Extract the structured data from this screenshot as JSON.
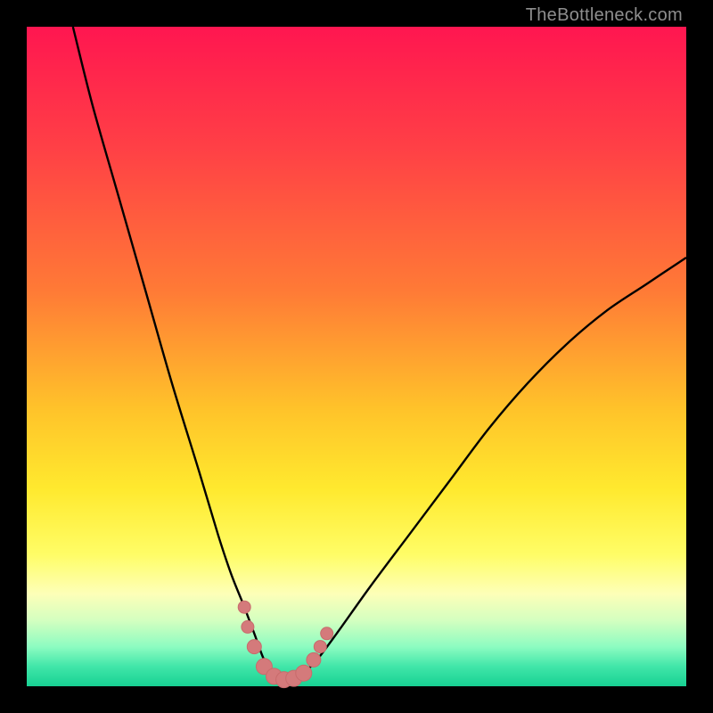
{
  "watermark": "TheBottleneck.com",
  "colors": {
    "curve_stroke": "#000000",
    "marker_fill": "#d47a7b",
    "marker_stroke": "#c86b6c",
    "gradient_top": "#ff1650",
    "gradient_bottom": "#17d193",
    "background": "#000000"
  },
  "chart_data": {
    "type": "line",
    "title": "",
    "xlabel": "",
    "ylabel": "",
    "xlim": [
      0,
      100
    ],
    "ylim": [
      0,
      100
    ],
    "grid": false,
    "legend": false,
    "note": "Bottleneck-style V curve; y ≈ 0 is optimal (green), y ≈ 100 is worst (red). No numeric axis labels shown.",
    "series": [
      {
        "name": "curve",
        "x": [
          7,
          10,
          14,
          18,
          22,
          26,
          29,
          31,
          33,
          34.5,
          36,
          37.5,
          39,
          40.5,
          42,
          44,
          47,
          52,
          58,
          64,
          70,
          76,
          82,
          88,
          94,
          100
        ],
        "y": [
          100,
          88,
          74,
          60,
          46,
          33,
          23,
          17,
          12,
          8,
          4,
          2,
          1,
          1,
          2,
          4,
          8,
          15,
          23,
          31,
          39,
          46,
          52,
          57,
          61,
          65
        ]
      }
    ],
    "markers": {
      "name": "highlight-points",
      "x": [
        33,
        33.5,
        34.5,
        36,
        37.5,
        39,
        40.5,
        42,
        43.5,
        44.5,
        45.5
      ],
      "y": [
        12,
        9,
        6,
        3,
        1.5,
        1,
        1.2,
        2,
        4,
        6,
        8
      ],
      "r": [
        7,
        7,
        8,
        9,
        9,
        9,
        9,
        9,
        8,
        7,
        7
      ]
    }
  }
}
